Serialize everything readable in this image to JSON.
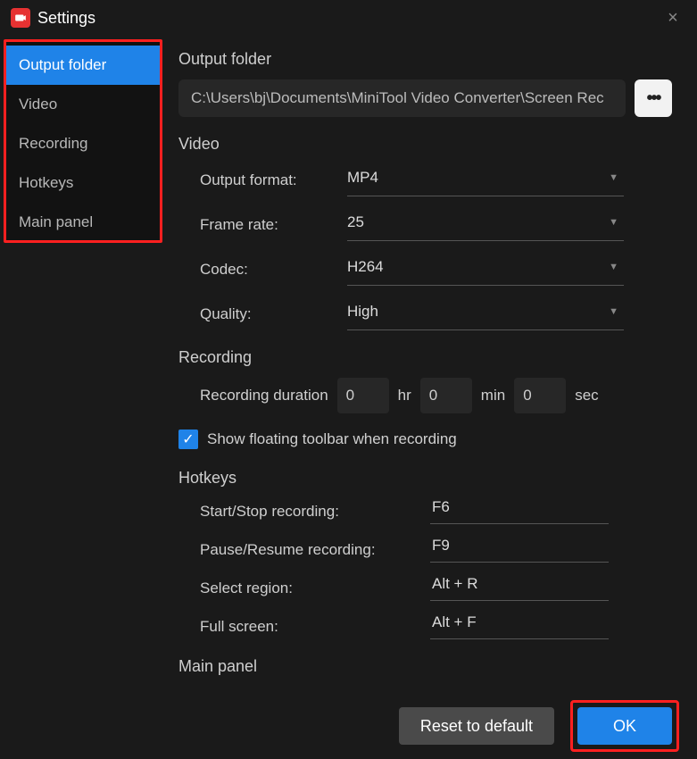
{
  "window": {
    "title": "Settings",
    "close_glyph": "×"
  },
  "sidebar": {
    "items": [
      {
        "label": "Output folder",
        "active": true
      },
      {
        "label": "Video",
        "active": false
      },
      {
        "label": "Recording",
        "active": false
      },
      {
        "label": "Hotkeys",
        "active": false
      },
      {
        "label": "Main panel",
        "active": false
      }
    ]
  },
  "sections": {
    "output": {
      "title": "Output folder",
      "path": "C:\\Users\\bj\\Documents\\MiniTool Video Converter\\Screen Rec",
      "browse_glyph": "•••"
    },
    "video": {
      "title": "Video",
      "fields": {
        "output_format": {
          "label": "Output format:",
          "value": "MP4"
        },
        "frame_rate": {
          "label": "Frame rate:",
          "value": "25"
        },
        "codec": {
          "label": "Codec:",
          "value": "H264"
        },
        "quality": {
          "label": "Quality:",
          "value": "High"
        }
      }
    },
    "recording": {
      "title": "Recording",
      "duration_label": "Recording duration",
      "hr_label": "hr",
      "min_label": "min",
      "sec_label": "sec",
      "hr_value": "0",
      "min_value": "0",
      "sec_value": "0",
      "show_toolbar_label": "Show floating toolbar when recording",
      "show_toolbar_checked": true
    },
    "hotkeys": {
      "title": "Hotkeys",
      "rows": {
        "start_stop": {
          "label": "Start/Stop recording:",
          "value": "F6"
        },
        "pause_resume": {
          "label": "Pause/Resume recording:",
          "value": "F9"
        },
        "select_region": {
          "label": "Select region:",
          "value": "Alt + R"
        },
        "full_screen": {
          "label": "Full screen:",
          "value": "Alt + F"
        }
      }
    },
    "main_panel": {
      "title": "Main panel"
    }
  },
  "footer": {
    "reset_label": "Reset to default",
    "ok_label": "OK"
  }
}
